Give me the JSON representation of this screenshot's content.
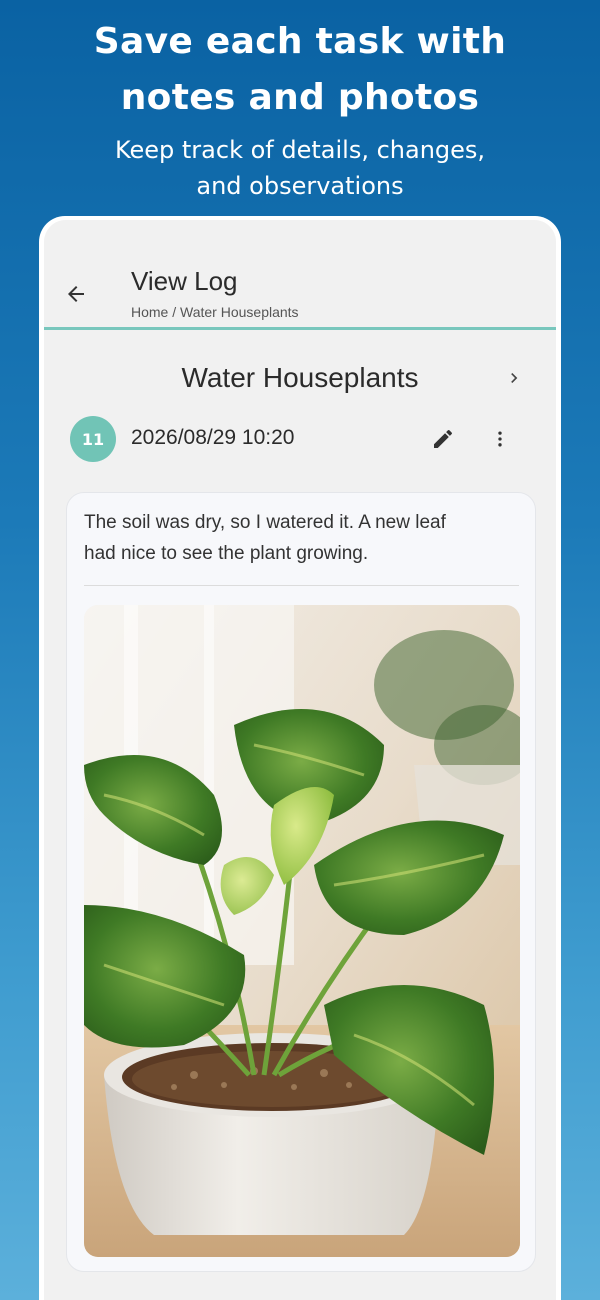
{
  "promo": {
    "headline_line1": "Save each task with",
    "headline_line2": "notes and photos",
    "subline_line1": "Keep track of details, changes,",
    "subline_line2": "and observations"
  },
  "appbar": {
    "back_icon": "arrow-left-icon",
    "title": "View Log",
    "breadcrumb": "Home / Water Houseplants"
  },
  "task": {
    "title": "Water Houseplants",
    "next_icon": "chevron-right-icon"
  },
  "entry": {
    "count": "11",
    "datetime": "2026/08/29 10:20",
    "edit_icon": "pencil-icon",
    "more_icon": "more-vertical-icon",
    "note_line1": "The soil was dry, so I watered it. A new leaf",
    "note_line2": "had nice to see the plant growing.",
    "photo_icon": "plant-photo"
  },
  "colors": {
    "accent_teal": "#71c4b6",
    "background_top": "#0a62a3",
    "background_bottom": "#5cb0db"
  }
}
